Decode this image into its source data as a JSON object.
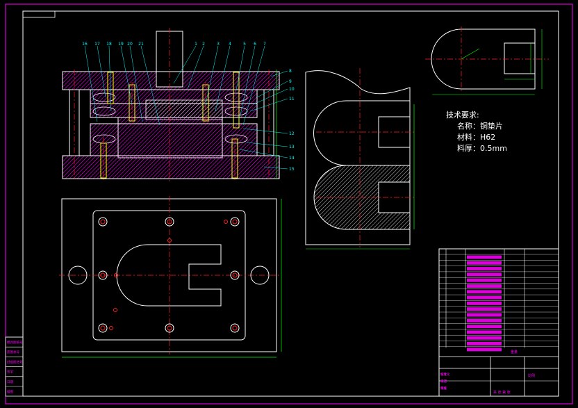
{
  "tech_requirements": {
    "title": "技术要求:",
    "lines": [
      "名称：铜垫片",
      "材料：H62",
      "料厚：0.5mm"
    ]
  },
  "balloons_top": [
    "16",
    "17",
    "18",
    "19",
    "20",
    "21",
    "1",
    "2",
    "3",
    "4",
    "5",
    "6",
    "7"
  ],
  "balloons_right": [
    "8",
    "9",
    "10",
    "11",
    "12",
    "13",
    "14",
    "15"
  ],
  "left_strip_labels": [
    "模具图纸号",
    "底图总号",
    "旧底图总号",
    "签字",
    "日期",
    "描图"
  ],
  "title_block": {
    "bottom_left": [
      "设计",
      "校对",
      "审核",
      "标准化",
      "工艺",
      "批准"
    ],
    "scale_label": "比例",
    "sheet_label": "共 张 第 张",
    "weight_label": "重量"
  },
  "colors": {
    "frame": "#ff00ff",
    "outline": "#ffffff",
    "center": "#ff2020",
    "dim": "#00ff00",
    "hatch": "#ff00ff",
    "balloon": "#00ffff",
    "background": "#000000"
  }
}
